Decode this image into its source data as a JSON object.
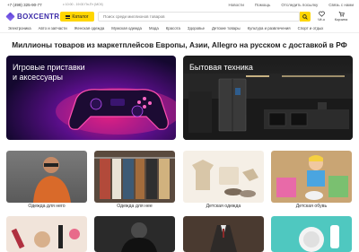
{
  "topbar": {
    "phone": "+7 (499) 325-90-77",
    "hours": "с 10:00 - 19:00 Пн-Пт (МСК)",
    "links": [
      "Новости",
      "Помощь",
      "Отследить посылку",
      "Связь с нами"
    ]
  },
  "header": {
    "logo": "BOXCENTR",
    "catalog_label": "Каталог",
    "search_placeholder": "Поиск среди миллионов товаров",
    "favorites_label": "Чё-о",
    "cart_label": "Корзина"
  },
  "nav": [
    "Электроника",
    "Авто и запчасти",
    "Женская одежда",
    "Мужская одежда",
    "Мода",
    "Красота",
    "Здоровье",
    "Детские товары",
    "Культура и развлечения",
    "Спорт и отдых"
  ],
  "headline": "Миллионы товаров из маркетплейсов Европы, Азии, Allegro на русском с доставкой в РФ",
  "heroes": [
    {
      "title_line1": "Игровые приставки",
      "title_line2": "и аксессуары"
    },
    {
      "title_line1": "Бытовая техника",
      "title_line2": ""
    }
  ],
  "categories": [
    {
      "label": "Одежда для него"
    },
    {
      "label": "Одежда для нее"
    },
    {
      "label": "Детская одежда"
    },
    {
      "label": "Детская обувь"
    }
  ],
  "colors": {
    "accent": "#ffd600",
    "brand": "#3b2aa8"
  }
}
